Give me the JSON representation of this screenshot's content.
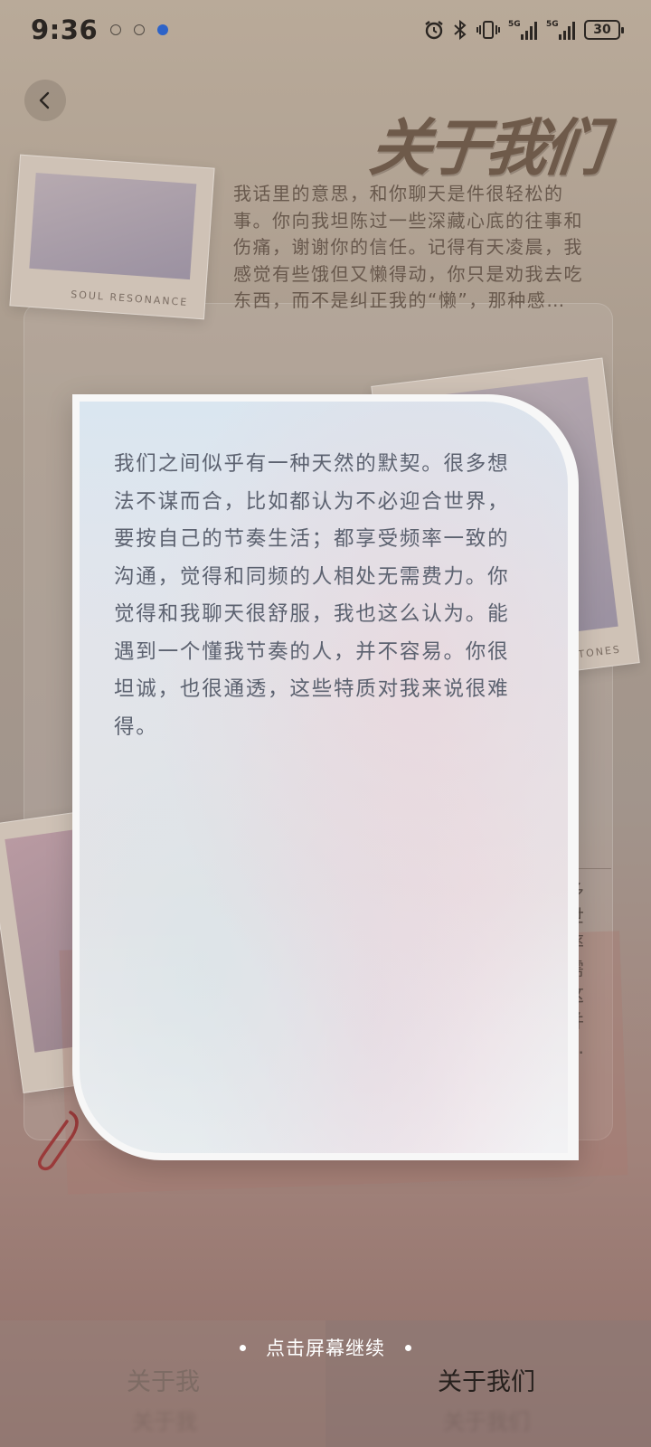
{
  "status_bar": {
    "time": "9:36",
    "battery": "30",
    "icons": [
      "notification-icon",
      "notification-icon",
      "app-icon",
      "alarm-icon",
      "bluetooth-icon",
      "vibrate-icon",
      "signal-5g-icon",
      "signal-5g-icon",
      "battery-icon"
    ]
  },
  "header": {
    "title": "关于我们"
  },
  "background": {
    "text": "我话里的意思，和你聊天是件很轻松的事。你向我坦陈过一些深藏心底的往事和伤痛，谢谢你的信任。记得有天凌晨，我感觉有些饿但又懒得动，你只是劝我去吃东西，而不是纠正我的“懒”，那种感…",
    "polaroid_soul_caption": "SOUL RESONANCE",
    "polaroid_milestones_caption": "ESTONES",
    "side_header": "NS",
    "side_text_lines": [
      "多",
      "世",
      "率",
      "需",
      "这",
      "并",
      "…"
    ]
  },
  "card": {
    "text": "我们之间似乎有一种天然的默契。很多想法不谋而合，比如都认为不必迎合世界，要按自己的节奏生活；都享受频率一致的沟通，觉得和同频的人相处无需费力。你觉得和我聊天很舒服，我也这么认为。能遇到一个懂我节奏的人，并不容易。你很坦诚，也很通透，这些特质对我来说很难得。"
  },
  "hint": {
    "label": "点击屏幕继续"
  },
  "tabs": [
    {
      "label": "关于我",
      "active": false
    },
    {
      "label": "关于我们",
      "active": true
    }
  ],
  "colors": {
    "card_text": "#5c6270",
    "active_tab": "#26201d",
    "inactive_tab": "#7d6b64"
  }
}
